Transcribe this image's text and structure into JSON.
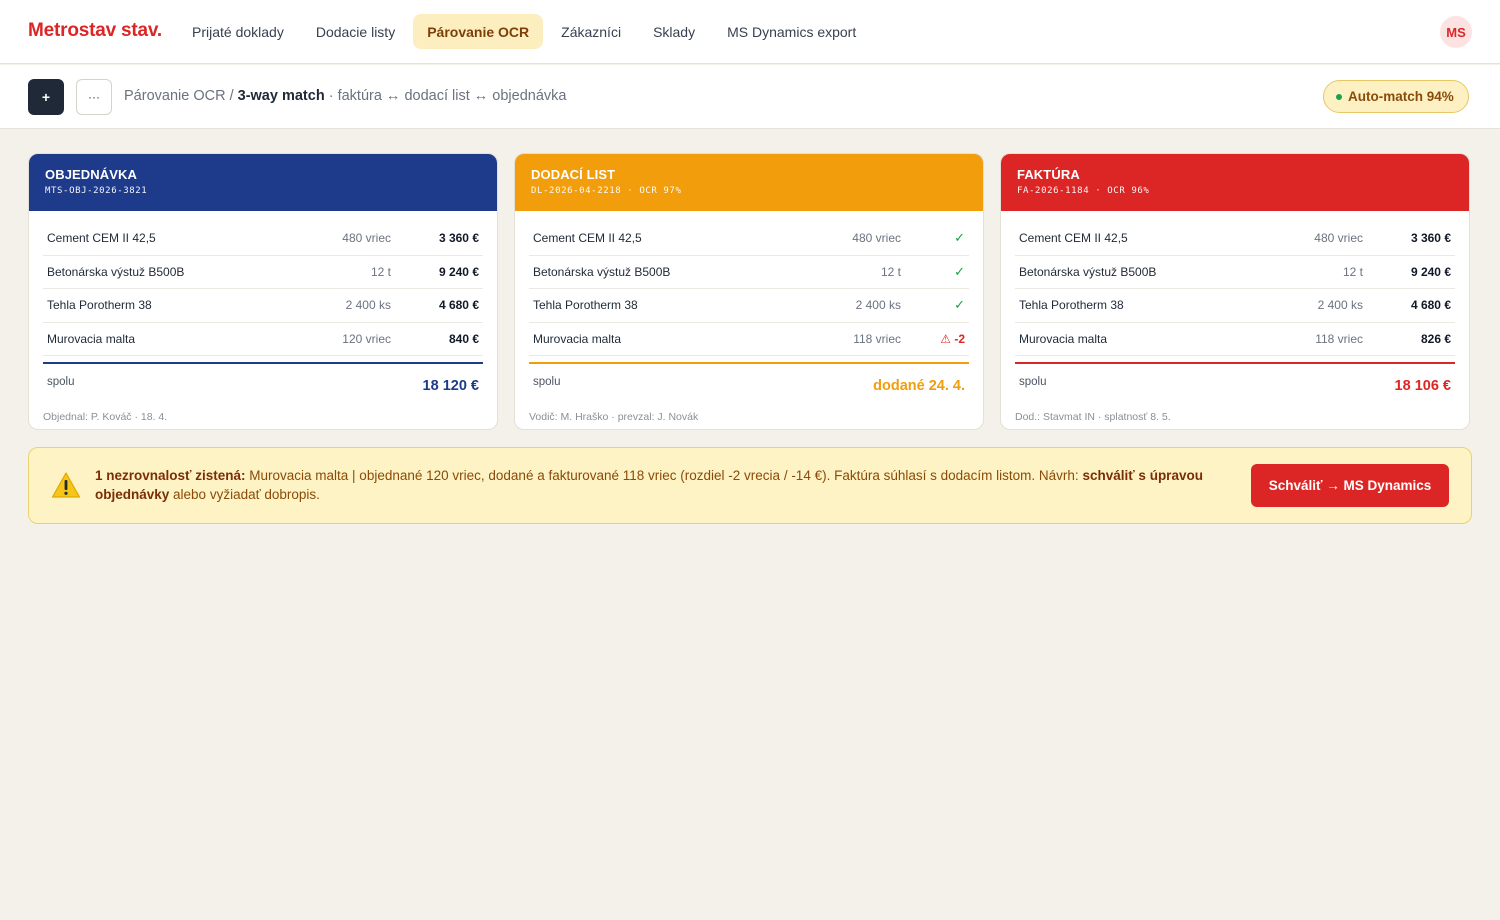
{
  "app": {
    "logo": "Metrostav stav.",
    "user_initials": "MS"
  },
  "nav": {
    "items": [
      {
        "label": "Prijaté doklady",
        "active": false
      },
      {
        "label": "Dodacie listy",
        "active": false
      },
      {
        "label": "Párovanie OCR",
        "active": true
      },
      {
        "label": "Zákazníci",
        "active": false
      },
      {
        "label": "Sklady",
        "active": false
      },
      {
        "label": "MS Dynamics export",
        "active": false
      }
    ]
  },
  "toolbar": {
    "add_label": "+",
    "more_label": "···",
    "breadcrumb_root": "Párovanie OCR",
    "breadcrumb_sep": " / ",
    "breadcrumb_current": "3-way match",
    "breadcrumb_desc": " · faktúra ↔ dodací list ↔ objednávka",
    "automatch_label": "Auto-match 94%"
  },
  "cards": [
    {
      "title": "OBJEDNÁVKA",
      "code": "MTS-OBJ-2026-3821",
      "color": "#1e3a8a",
      "rows": [
        {
          "name": "Cement CEM II 42,5",
          "qty": "480 vriec",
          "value": "3 360 €"
        },
        {
          "name": "Betonárska výstuž B500B",
          "qty": "12 t",
          "value": "9 240 €"
        },
        {
          "name": "Tehla Porotherm 38",
          "qty": "2 400 ks",
          "value": "4 680 €"
        },
        {
          "name": "Murovacia malta",
          "qty": "120 vriec",
          "value": "840 €"
        }
      ],
      "total_label": "spolu",
      "total_value": "18 120 €",
      "footer": "Objednal: P. Kováč · 18. 4."
    },
    {
      "title": "DODACÍ LIST",
      "code": "DL-2026-04-2218 · OCR 97%",
      "color": "#f29d0c",
      "rows": [
        {
          "name": "Cement CEM II 42,5",
          "qty": "480 vriec",
          "status": "✓",
          "status_type": "ok"
        },
        {
          "name": "Betonárska výstuž B500B",
          "qty": "12 t",
          "status": "✓",
          "status_type": "ok"
        },
        {
          "name": "Tehla Porotherm 38",
          "qty": "2 400 ks",
          "status": "✓",
          "status_type": "ok"
        },
        {
          "name": "Murovacia malta",
          "qty": "118 vriec",
          "status": "⚠ -2",
          "status_type": "warn"
        }
      ],
      "total_label": "spolu",
      "total_value": "dodané 24. 4.",
      "footer": "Vodič: M. Hraško · prevzal: J. Novák"
    },
    {
      "title": "FAKTÚRA",
      "code": "FA-2026-1184 · OCR 96%",
      "color": "#dc2626",
      "rows": [
        {
          "name": "Cement CEM II 42,5",
          "qty": "480 vriec",
          "value": "3 360 €"
        },
        {
          "name": "Betonárska výstuž B500B",
          "qty": "12 t",
          "value": "9 240 €"
        },
        {
          "name": "Tehla Porotherm 38",
          "qty": "2 400 ks",
          "value": "4 680 €"
        },
        {
          "name": "Murovacia malta",
          "qty": "118 vriec",
          "value": "826 €"
        }
      ],
      "total_label": "spolu",
      "total_value": "18 106 €",
      "footer": "Dod.: Stavmat IN · splatnosť 8. 5."
    }
  ],
  "alert": {
    "icon": "warning-icon",
    "lead": "1 nezrovnalosť zistená:",
    "message": " Murovacia malta | objednané 120 vriec, dodané a fakturované 118 vriec (rozdiel -2 vrecia / -14 €). Faktúra súhlasí s dodacím listom. Návrh: ",
    "proposal": "schváliť s úpravou objednávky",
    "tail": " alebo vyžiadať dobropis.",
    "action_label": "Schváliť → MS Dynamics"
  },
  "colors": {
    "accent": "#dc2626",
    "order": "#1e3a8a",
    "delivery": "#f29d0c",
    "invoice": "#dc2626",
    "ok": "#16a34a"
  }
}
